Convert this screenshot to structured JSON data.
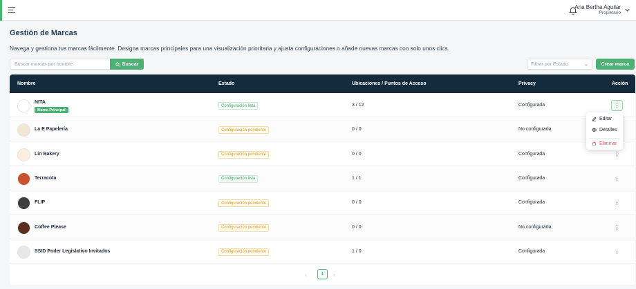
{
  "header": {
    "user_name": "Ana Bertha Aguilar",
    "user_role": "Propietario",
    "icons": [
      "menu-icon",
      "bell-icon",
      "chevron-down-icon"
    ]
  },
  "page": {
    "title": "Gestión de Marcas",
    "description": "Navega y gestiona tus marcas fácilmente. Designa marcas principales para una visualización prioritaria y ajusta configuraciones o añade nuevas marcas con solo unos clics."
  },
  "search": {
    "placeholder": "Buscar marcas por nombre",
    "button_label": "Buscar"
  },
  "filter": {
    "placeholder": "Filtrar por Estado"
  },
  "create_button_label": "Crear marca",
  "table": {
    "headers": {
      "name": "Nombre",
      "status": "Estado",
      "locations": "Ubicaciones / Puntos de Acceso",
      "privacy": "Privacy",
      "action": "Acción"
    },
    "rows": [
      {
        "name": "NITA",
        "principal": "Marca Principal",
        "status": "Configuración lista",
        "status_type": "ok",
        "locations": "3 / 12",
        "privacy": "Configurada",
        "logo_color": "#ffffff"
      },
      {
        "name": "La E Papelería",
        "status": "Configuración pendiente",
        "status_type": "pend",
        "locations": "0 / 0",
        "privacy": "No configurada",
        "logo_color": "#f4e6d4"
      },
      {
        "name": "Lin Bakery",
        "status": "Configuración pendiente",
        "status_type": "pend",
        "locations": "0 / 0",
        "privacy": "Configurada",
        "logo_color": "#fbeee0"
      },
      {
        "name": "Terracota",
        "status": "Configuración lista",
        "status_type": "ok",
        "locations": "1 / 1",
        "privacy": "Configurada",
        "logo_color": "#c8512e"
      },
      {
        "name": "FLIP",
        "status": "Configuración pendiente",
        "status_type": "pend",
        "locations": "0 / 0",
        "privacy": "Configurada",
        "logo_color": "#3d3d3d"
      },
      {
        "name": "Coffee Please",
        "status": "Configuración pendiente",
        "status_type": "pend",
        "locations": "0 / 0",
        "privacy": "No configurada",
        "logo_color": "#5a2d1f"
      },
      {
        "name": "SSID Poder Legislativo Invitados",
        "status": "Configuración pendiente",
        "status_type": "pend",
        "locations": "1 / 0",
        "privacy": "Configurada",
        "logo_color": "#e8e8ea"
      }
    ]
  },
  "dropdown": {
    "edit": "Editar",
    "details": "Detalles",
    "delete": "Eliminar"
  },
  "pagination": {
    "current": "1",
    "prev": "‹",
    "next": "›"
  }
}
